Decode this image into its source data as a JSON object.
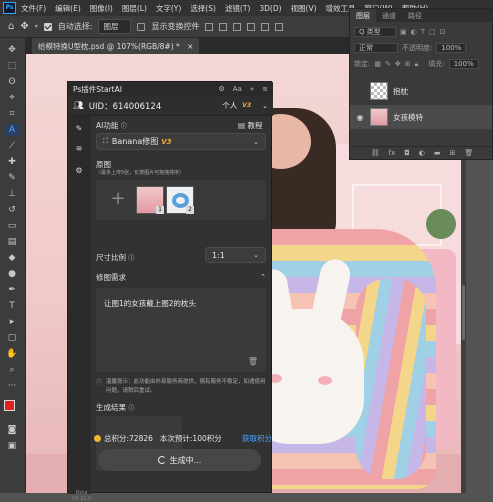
{
  "menubar": {
    "logo": "Ps",
    "items": [
      "文件(F)",
      "编辑(E)",
      "图像(I)",
      "图层(L)",
      "文字(Y)",
      "选择(S)",
      "滤镜(T)",
      "3D(D)",
      "视图(V)",
      "增效工具",
      "窗口(W)",
      "帮助(H)"
    ]
  },
  "options": {
    "auto_select": "自动选择:",
    "layer_select": "图层",
    "show_transform": "显示变换控件"
  },
  "document": {
    "tab_title": "给模特换U型枕.psd @ 107%(RGB/8#) *",
    "close": "×"
  },
  "layers_panel": {
    "tabs": [
      "图层",
      "通道",
      "路径"
    ],
    "filter_label": "Q 类型",
    "blend_mode": "正常",
    "opacity_label": "不透明度:",
    "opacity_value": "100%",
    "lock_label": "锁定:",
    "fill_label": "填充:",
    "fill_value": "100%",
    "layers": [
      {
        "name": "抱枕",
        "visible": false
      },
      {
        "name": "女孩模特",
        "visible": true
      }
    ],
    "footer_icons": [
      "link-icon",
      "fx-icon",
      "mask-icon",
      "adjustment-icon",
      "folder-icon",
      "new-layer-icon",
      "trash-icon"
    ]
  },
  "plugin": {
    "title": "Ps插件StartAI",
    "user_id": "UID：614006124",
    "account_type": "个人",
    "account_version": "V3",
    "ai_function_label": "AI功能",
    "tutorial_label": "教程",
    "model": "Banana修图",
    "model_version": "V3",
    "source_label": "原图",
    "source_hint": "（最多上传5张，长按图片可拖拽排序）",
    "image_badges": [
      "1",
      "2"
    ],
    "ratio_label": "尺寸比例",
    "ratio_value": "1:1",
    "requirement_label": "修图需求",
    "requirement_text": "让图1的女孩戴上图2的枕头",
    "tip_text": "温馨提示：此功能由外部服务商提供，偶有服务不稳定，如遇使用问题，请稍后重试。",
    "result_label": "生成结果",
    "points_label": "总积分:72826",
    "estimate_label": "本次预计:100积分",
    "get_points": "获取积分",
    "generate_button": "生成中...",
    "beta": "Beta",
    "version": "V0.21.0"
  },
  "colors": {
    "accent": "#31a8ff",
    "brand_orange": "#f4a93c",
    "foreground_swatch": "#e0211c",
    "background_swatch": "#ffffff"
  }
}
